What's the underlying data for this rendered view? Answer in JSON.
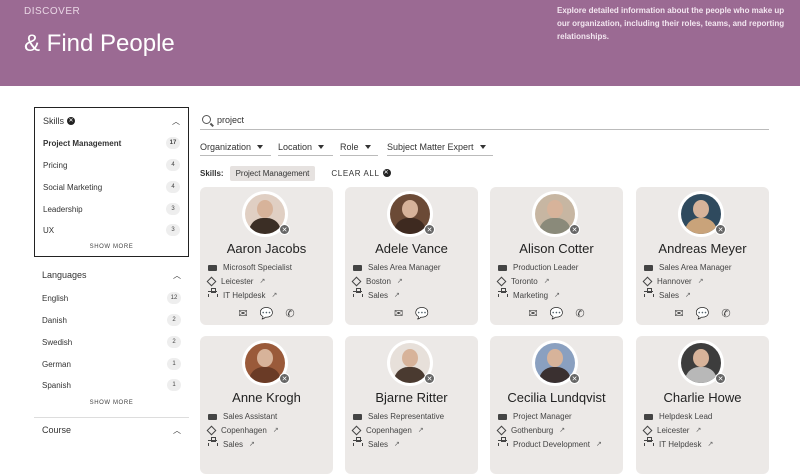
{
  "hero": {
    "eyebrow": "DISCOVER",
    "title": "& Find People",
    "description": "Explore detailed information about the people who make up our organization, including their roles, teams, and reporting relationships."
  },
  "sidebar": {
    "skills": {
      "label": "Skills",
      "items": [
        {
          "label": "Project Management",
          "count": "17"
        },
        {
          "label": "Pricing",
          "count": "4"
        },
        {
          "label": "Social Marketing",
          "count": "4"
        },
        {
          "label": "Leadership",
          "count": "3"
        },
        {
          "label": "UX",
          "count": "3"
        }
      ],
      "show_more": "SHOW MORE"
    },
    "languages": {
      "label": "Languages",
      "items": [
        {
          "label": "English",
          "count": "12"
        },
        {
          "label": "Danish",
          "count": "2"
        },
        {
          "label": "Swedish",
          "count": "2"
        },
        {
          "label": "German",
          "count": "1"
        },
        {
          "label": "Spanish",
          "count": "1"
        }
      ],
      "show_more": "SHOW MORE"
    },
    "course": {
      "label": "Course"
    }
  },
  "search": {
    "value": "project"
  },
  "filters": [
    "Organization",
    "Location",
    "Role",
    "Subject Matter Expert"
  ],
  "active_filters": {
    "label": "Skills:",
    "chip": "Project Management",
    "clear": "CLEAR ALL"
  },
  "people": [
    {
      "name": "Aaron Jacobs",
      "role": "Microsoft Specialist",
      "location": "Leicester",
      "team": "IT Helpdesk",
      "actions": [
        "mail",
        "chat",
        "phone"
      ]
    },
    {
      "name": "Adele Vance",
      "role": "Sales Area Manager",
      "location": "Boston",
      "team": "Sales",
      "actions": [
        "mail",
        "chat"
      ]
    },
    {
      "name": "Alison Cotter",
      "role": "Production Leader",
      "location": "Toronto",
      "team": "Marketing",
      "actions": [
        "mail",
        "chat",
        "phone"
      ]
    },
    {
      "name": "Andreas Meyer",
      "role": "Sales Area Manager",
      "location": "Hannover",
      "team": "Sales",
      "actions": [
        "mail",
        "chat",
        "phone"
      ]
    },
    {
      "name": "Anne Krogh",
      "role": "Sales Assistant",
      "location": "Copenhagen",
      "team": "Sales"
    },
    {
      "name": "Bjarne Ritter",
      "role": "Sales Representative",
      "location": "Copenhagen",
      "team": "Sales"
    },
    {
      "name": "Cecilia Lundqvist",
      "role": "Project Manager",
      "location": "Gothenburg",
      "team": "Product Development"
    },
    {
      "name": "Charlie Howe",
      "role": "Helpdesk Lead",
      "location": "Leicester",
      "team": "IT Helpdesk"
    }
  ],
  "colors": {
    "hero": "#9b6a93",
    "card": "#ece9e7"
  }
}
